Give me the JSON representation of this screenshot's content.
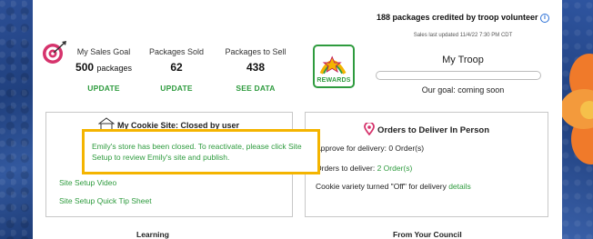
{
  "goal": {
    "label": "My Sales Goal",
    "value": "500",
    "unit": "packages",
    "action": "UPDATE"
  },
  "sold": {
    "label": "Packages Sold",
    "value": "62",
    "action": "UPDATE"
  },
  "to_sell": {
    "label": "Packages to Sell",
    "value": "438",
    "action": "SEE DATA"
  },
  "rewards": {
    "label": "REWARDS"
  },
  "troop": {
    "credited": "188 packages credited by troop volunteer",
    "updated": "Sales last updated 11/4/22 7:30 PM CDT",
    "title": "My Troop",
    "goal": "Our goal: coming soon",
    "progress_fraction": 0
  },
  "site_box": {
    "title": "My Cookie Site: Closed by user",
    "links": [
      "Site Setup Video",
      "Site Setup Quick Tip Sheet"
    ]
  },
  "callout": {
    "text": "Emily's store has been closed. To reactivate, please click Site Setup to review Emily's site and publish."
  },
  "orders_box": {
    "title": "Orders to Deliver In Person",
    "approve_label": "Approve for delivery:",
    "approve_value": "0 Order(s)",
    "deliver_label": "Orders to deliver:",
    "deliver_value": "2 Order(s)",
    "variety_label": "Cookie variety turned \"Off\" for delivery",
    "variety_link": "details"
  },
  "bottom": {
    "learning": "Learning",
    "council": "From Your Council"
  },
  "colors": {
    "accent_green": "#2e9b3e",
    "highlight": "#f4b400",
    "target_pink": "#d6336c"
  }
}
